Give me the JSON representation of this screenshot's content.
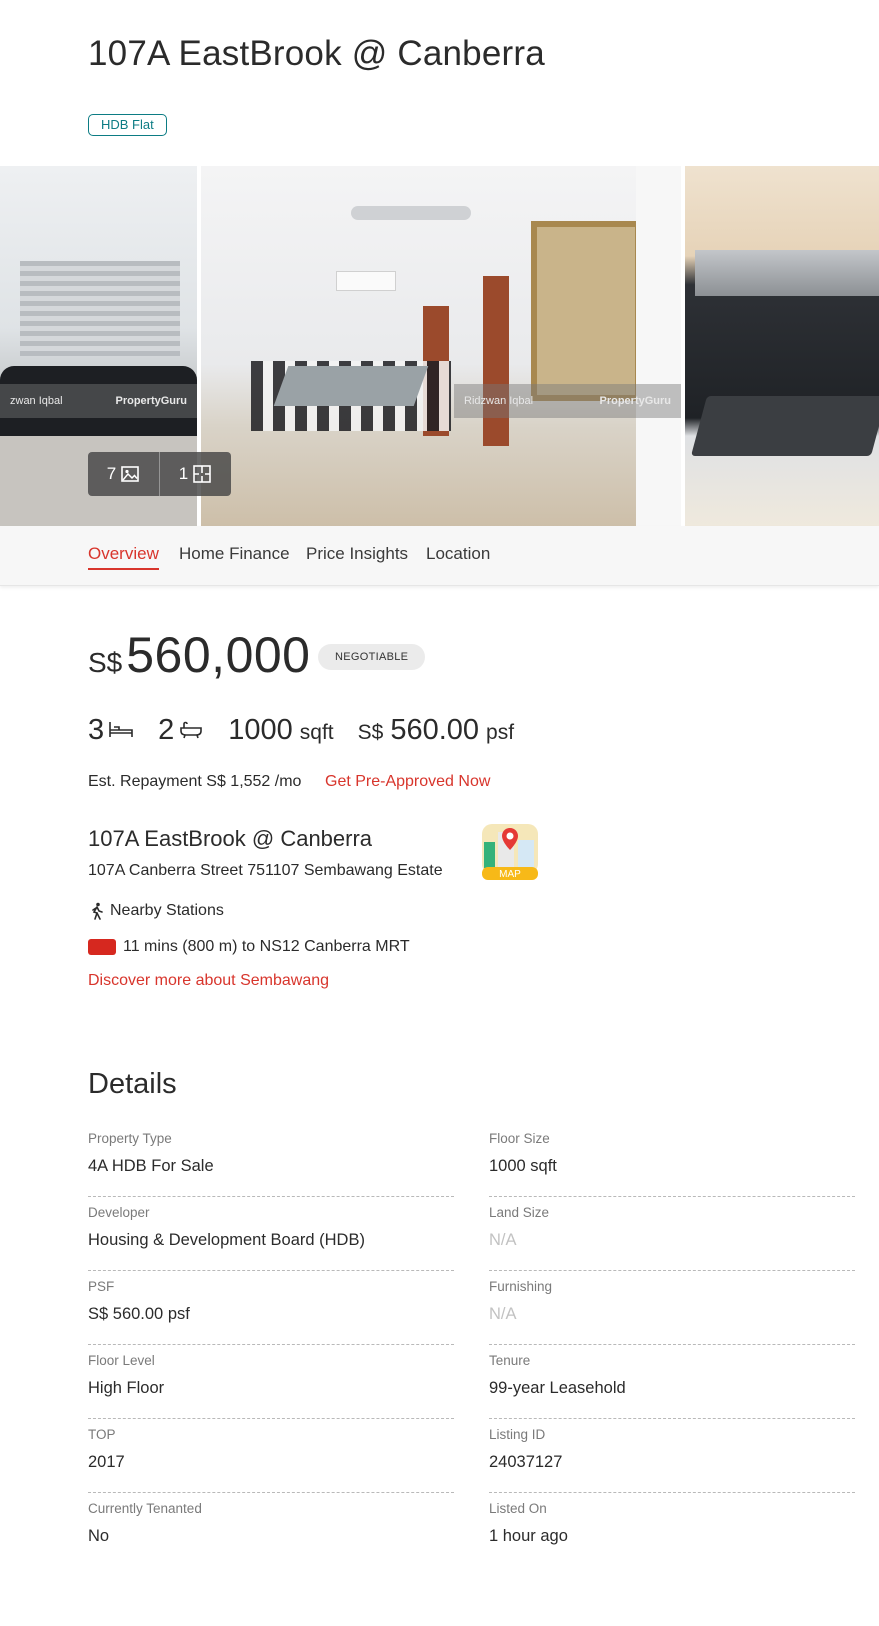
{
  "listing": {
    "title": "107A EastBrook @ Canberra",
    "property_badge": "HDB Flat"
  },
  "gallery": {
    "photo_count": "7",
    "floorplan_count": "1",
    "watermark_left": "zwan Iqbal",
    "watermark_mid": "Ridzwan Iqbal",
    "brand_1": "PropertyGuru",
    "brand_2": "PropertyGuru"
  },
  "tabs": [
    {
      "label": "Overview",
      "active": true
    },
    {
      "label": "Home Finance",
      "active": false
    },
    {
      "label": "Price Insights",
      "active": false
    },
    {
      "label": "Location",
      "active": false
    }
  ],
  "price": {
    "currency": "S$",
    "amount": "560,000",
    "tag": "NEGOTIABLE"
  },
  "specs": {
    "bedrooms": "3",
    "bathrooms": "2",
    "size_value": "1000",
    "size_unit": "sqft",
    "psf_currency": "S$",
    "psf_value": "560.00",
    "psf_unit": "psf"
  },
  "finance": {
    "repayment": "Est. Repayment S$ 1,552 /mo",
    "cta": "Get Pre-Approved Now"
  },
  "address": {
    "name": "107A EastBrook @ Canberra",
    "line": "107A Canberra Street 751107 Sembawang Estate",
    "map_label": "MAP"
  },
  "transport": {
    "heading": "Nearby Stations",
    "station": "11 mins (800 m) to NS12 Canberra MRT",
    "mrt_color": "#d6281f",
    "discover": "Discover more about Sembawang"
  },
  "details": {
    "heading": "Details",
    "left": [
      {
        "label": "Property Type",
        "value": "4A HDB For Sale"
      },
      {
        "label": "Developer",
        "value": "Housing & Development Board (HDB)"
      },
      {
        "label": "PSF",
        "value": "S$ 560.00 psf"
      },
      {
        "label": "Floor Level",
        "value": "High Floor"
      },
      {
        "label": "TOP",
        "value": "2017"
      },
      {
        "label": "Currently Tenanted",
        "value": "No"
      }
    ],
    "right": [
      {
        "label": "Floor Size",
        "value": "1000 sqft"
      },
      {
        "label": "Land Size",
        "value": "N/A"
      },
      {
        "label": "Furnishing",
        "value": "N/A"
      },
      {
        "label": "Tenure",
        "value": "99-year Leasehold"
      },
      {
        "label": "Listing ID",
        "value": "24037127"
      },
      {
        "label": "Listed On",
        "value": "1 hour ago"
      }
    ]
  },
  "colors": {
    "accent": "#d8352c",
    "badge": "#0c7c84"
  }
}
